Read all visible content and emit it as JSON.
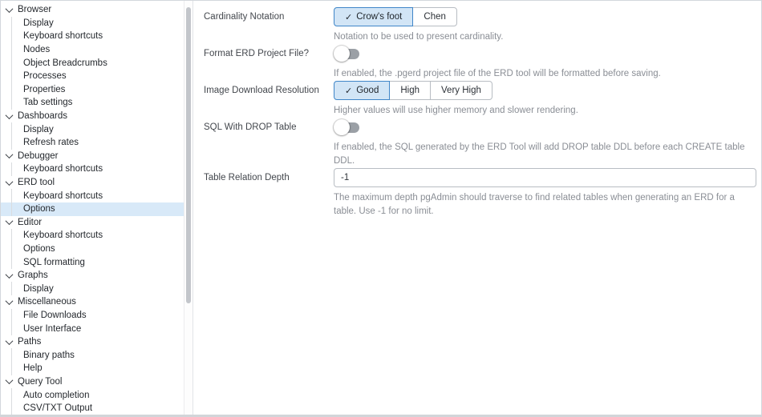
{
  "sidebar": {
    "tree": [
      {
        "label": "Browser",
        "type": "parent"
      },
      {
        "label": "Display",
        "type": "child"
      },
      {
        "label": "Keyboard shortcuts",
        "type": "child"
      },
      {
        "label": "Nodes",
        "type": "child"
      },
      {
        "label": "Object Breadcrumbs",
        "type": "child"
      },
      {
        "label": "Processes",
        "type": "child"
      },
      {
        "label": "Properties",
        "type": "child"
      },
      {
        "label": "Tab settings",
        "type": "child"
      },
      {
        "label": "Dashboards",
        "type": "parent"
      },
      {
        "label": "Display",
        "type": "child"
      },
      {
        "label": "Refresh rates",
        "type": "child"
      },
      {
        "label": "Debugger",
        "type": "parent"
      },
      {
        "label": "Keyboard shortcuts",
        "type": "child"
      },
      {
        "label": "ERD tool",
        "type": "parent"
      },
      {
        "label": "Keyboard shortcuts",
        "type": "child"
      },
      {
        "label": "Options",
        "type": "child",
        "selected": true
      },
      {
        "label": "Editor",
        "type": "parent"
      },
      {
        "label": "Keyboard shortcuts",
        "type": "child"
      },
      {
        "label": "Options",
        "type": "child"
      },
      {
        "label": "SQL formatting",
        "type": "child"
      },
      {
        "label": "Graphs",
        "type": "parent"
      },
      {
        "label": "Display",
        "type": "child"
      },
      {
        "label": "Miscellaneous",
        "type": "parent"
      },
      {
        "label": "File Downloads",
        "type": "child"
      },
      {
        "label": "User Interface",
        "type": "child"
      },
      {
        "label": "Paths",
        "type": "parent"
      },
      {
        "label": "Binary paths",
        "type": "child"
      },
      {
        "label": "Help",
        "type": "child"
      },
      {
        "label": "Query Tool",
        "type": "parent"
      },
      {
        "label": "Auto completion",
        "type": "child"
      },
      {
        "label": "CSV/TXT Output",
        "type": "child"
      }
    ]
  },
  "panel": {
    "fields": [
      {
        "label": "Cardinality Notation",
        "control": "button-group",
        "options": [
          "Crow's foot",
          "Chen"
        ],
        "selected": "Crow's foot",
        "help": "Notation to be used to present cardinality."
      },
      {
        "label": "Format ERD Project File?",
        "control": "toggle",
        "value": false,
        "help": "If enabled, the .pgerd project file of the ERD tool will be formatted before saving."
      },
      {
        "label": "Image Download Resolution",
        "control": "button-group",
        "options": [
          "Good",
          "High",
          "Very High"
        ],
        "selected": "Good",
        "help": "Higher values will use higher memory and slower rendering."
      },
      {
        "label": "SQL With DROP Table",
        "control": "toggle",
        "value": false,
        "help": "If enabled, the SQL generated by the ERD Tool will add DROP table DDL before each CREATE table DDL."
      },
      {
        "label": "Table Relation Depth",
        "control": "input",
        "value": "-1",
        "help": "The maximum depth pgAdmin should traverse to find related tables when generating an ERD for a table. Use -1 for no limit."
      }
    ]
  },
  "icons": {
    "check_glyph": "✓",
    "chevron": "chevron-down-icon"
  },
  "colors": {
    "selected_row_bg": "#d8e9f8",
    "selected_button_bg": "#d2e5f6",
    "selected_button_border": "#4086c8",
    "toggle_track": "#9ba0a6",
    "help_text": "#8a8e95"
  }
}
